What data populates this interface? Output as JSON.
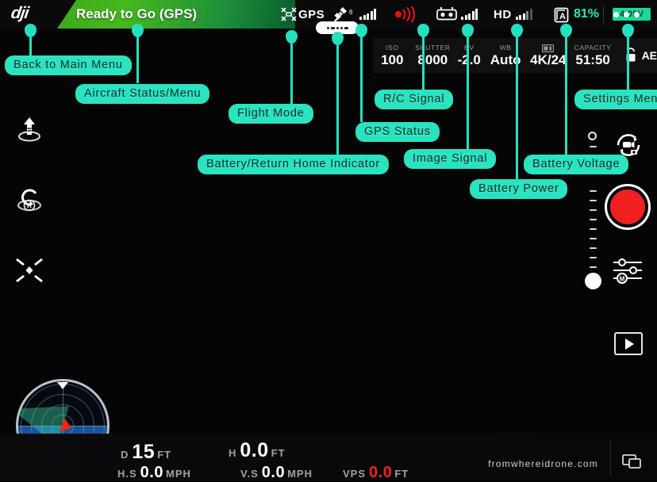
{
  "app": {
    "brand": "dji",
    "status_text": "Ready to Go (GPS)",
    "watermark": "fromwhereidrone.com"
  },
  "topbar": {
    "gps_label": "GPS",
    "satellite_count": "6",
    "hd_label": "HD",
    "battery_percent": "81%",
    "battery_voltage": "4.09V",
    "menu_label": "•••"
  },
  "camera_settings": [
    {
      "key": "ISO",
      "value": "100"
    },
    {
      "key": "SHUTTER",
      "value": "8000"
    },
    {
      "key": "EV",
      "value": "-2.0"
    },
    {
      "key": "WB",
      "value": "Auto"
    },
    {
      "key": "",
      "value": "4K/24"
    },
    {
      "key": "CAPACITY",
      "value": "51:50"
    }
  ],
  "ae_lock": {
    "label": "AE"
  },
  "left_rail": [
    {
      "name": "takeoff-icon",
      "tooltip": "Auto Takeoff"
    },
    {
      "name": "return-home-icon",
      "tooltip": "Return to Home"
    },
    {
      "name": "aircraft-map-icon",
      "tooltip": "Aircraft / Map Toggle"
    }
  ],
  "right_rail": {
    "camera_switch": "photo-video-switch-icon",
    "record_button": "record-button",
    "camera_settings": "camera-settings-icon",
    "playback": "playback-icon",
    "ev_slider_value": "knob-at-bottom"
  },
  "telemetry": {
    "distance": {
      "prefix": "D",
      "value": "15",
      "unit": "FT"
    },
    "height": {
      "prefix": "H",
      "value": "0.0",
      "unit": "FT"
    },
    "h_speed": {
      "prefix": "H.S",
      "value": "0.0",
      "unit": "MPH"
    },
    "v_speed": {
      "prefix": "V.S",
      "value": "0.0",
      "unit": "MPH"
    },
    "vps": {
      "prefix": "VPS",
      "value": "0.0",
      "unit": "FT"
    }
  },
  "radar": {
    "compass_badge": "N"
  },
  "annotations": [
    {
      "id": "back-to-main-menu",
      "label": "Back to Main Menu"
    },
    {
      "id": "aircraft-status-menu",
      "label": "Aircraft Status/Menu"
    },
    {
      "id": "flight-mode",
      "label": "Flight Mode"
    },
    {
      "id": "battery-return-home",
      "label": "Battery/Return Home Indicator"
    },
    {
      "id": "gps-status",
      "label": "GPS Status"
    },
    {
      "id": "rc-signal",
      "label": "R/C Signal"
    },
    {
      "id": "image-signal",
      "label": "Image Signal"
    },
    {
      "id": "battery-power",
      "label": "Battery Power"
    },
    {
      "id": "battery-voltage",
      "label": "Battery Voltage"
    },
    {
      "id": "settings-menu",
      "label": "Settings Menu"
    }
  ],
  "colors": {
    "accent_teal": "#2ae3c0",
    "status_green": "#46b81e",
    "record_red": "#ef2121",
    "battery_green": "#19d99a",
    "alert_red": "#ef2121"
  }
}
